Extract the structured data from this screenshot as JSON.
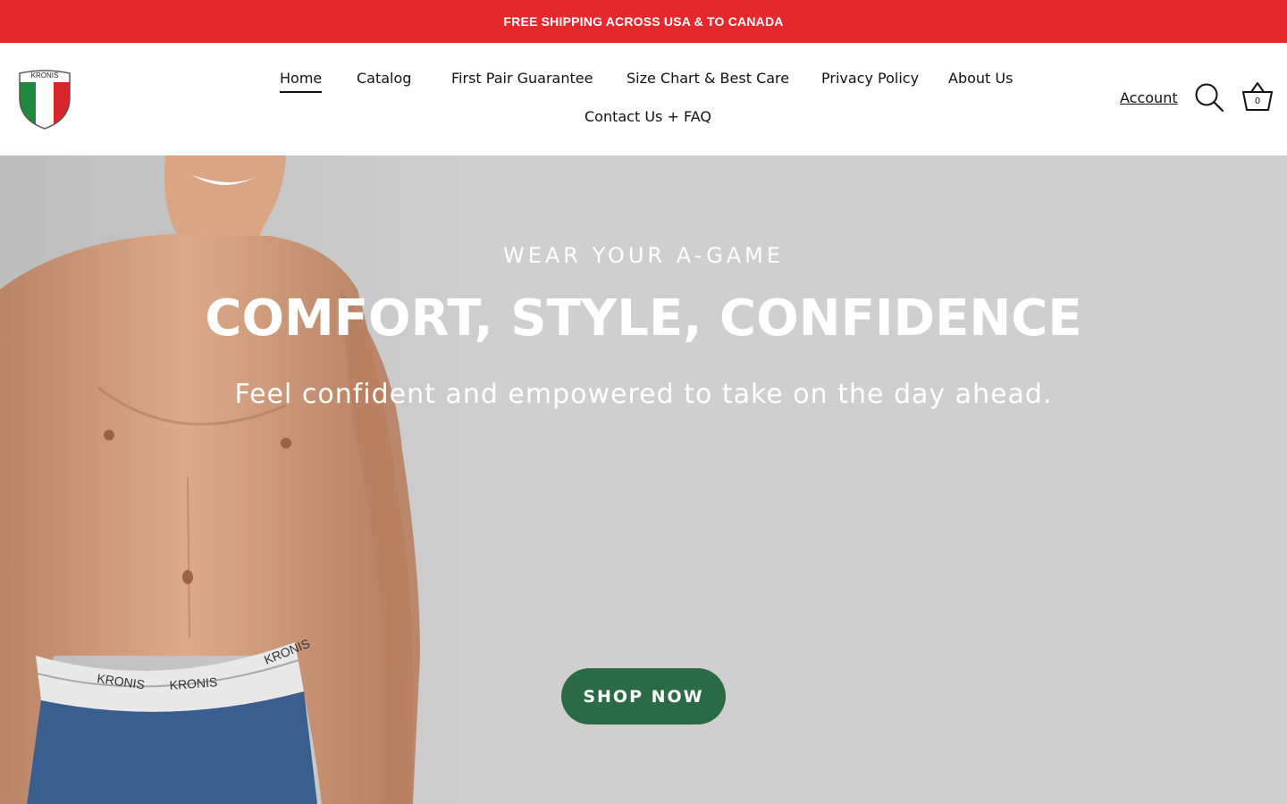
{
  "announcement": {
    "text": "FREE SHIPPING ACROSS USA & TO CANADA",
    "background": "#e4292c"
  },
  "header": {
    "logo_text": "KRONIS",
    "nav": [
      {
        "label": "Home",
        "active": true
      },
      {
        "label": "Catalog"
      },
      {
        "label": "First Pair Guarantee"
      },
      {
        "label": "Size Chart & Best Care"
      },
      {
        "label": "Privacy Policy"
      },
      {
        "label": "About Us"
      },
      {
        "label": "Contact Us + FAQ"
      }
    ],
    "account_label": "Account",
    "search_icon": "search-icon",
    "cart_icon": "basket-icon",
    "cart_count": "0"
  },
  "hero": {
    "eyebrow": "WEAR YOUR A-GAME",
    "headline": "COMFORT, STYLE, CONFIDENCE",
    "subheadline": "Feel confident and empowered to take on the day ahead.",
    "cta_label": "SHOP NOW",
    "cta_color": "#2a6b45",
    "background": "#cfcfcf",
    "waistband_text": "KRONIS"
  }
}
